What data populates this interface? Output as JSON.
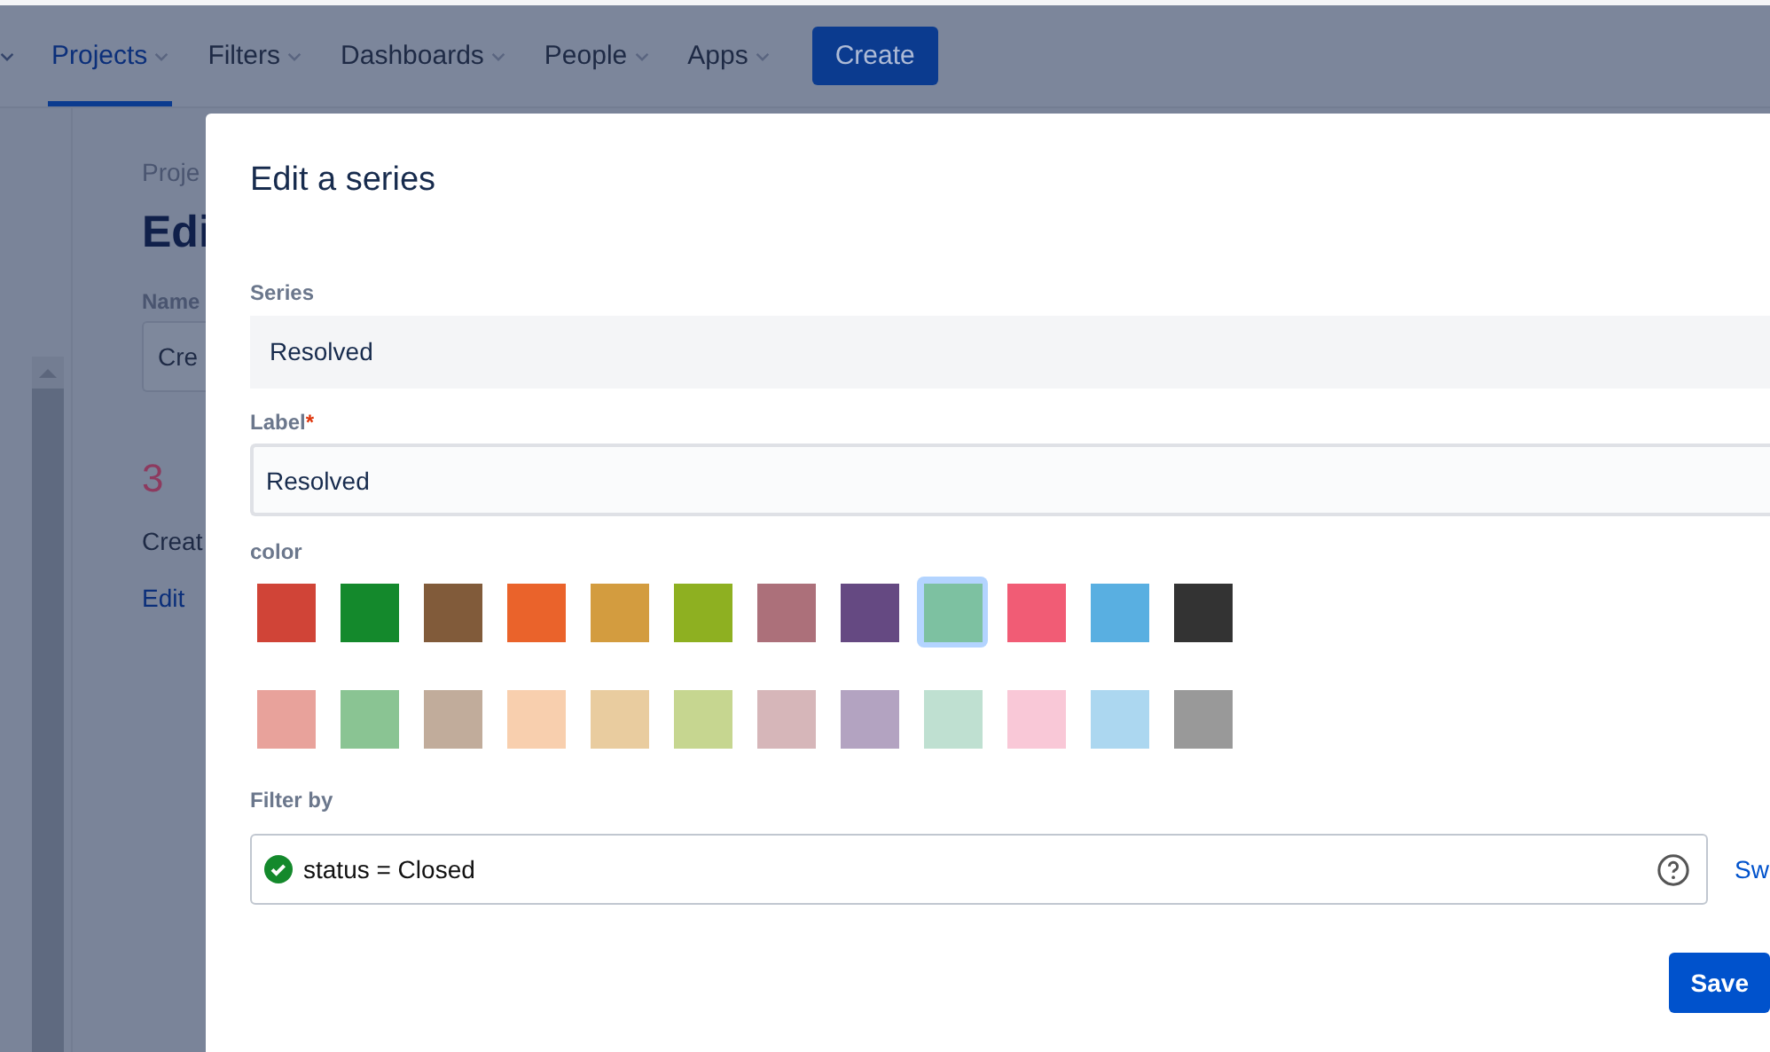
{
  "nav": {
    "items": [
      {
        "label": "Projects",
        "selected": true
      },
      {
        "label": "Filters",
        "selected": false
      },
      {
        "label": "Dashboards",
        "selected": false
      },
      {
        "label": "People",
        "selected": false
      },
      {
        "label": "Apps",
        "selected": false
      }
    ],
    "create_button": "Create"
  },
  "page": {
    "breadcrumb": "Proje",
    "heading": "Edi",
    "name_label": "Name",
    "name_field": "Cre",
    "count": "3",
    "text": "Creat",
    "link": "Edit"
  },
  "dialog": {
    "title": "Edit a series",
    "series": {
      "label": "Series",
      "value": "Resolved"
    },
    "label_field": {
      "label": "Label",
      "required": true,
      "required_mark": "*",
      "value": "Resolved"
    },
    "color": {
      "label": "color",
      "swatches": [
        {
          "color": "#d04437",
          "selected": false
        },
        {
          "color": "#14892c",
          "selected": false
        },
        {
          "color": "#815b3a",
          "selected": false
        },
        {
          "color": "#ea632b",
          "selected": false
        },
        {
          "color": "#d39c3f",
          "selected": false
        },
        {
          "color": "#8eb021",
          "selected": false
        },
        {
          "color": "#ac707a",
          "selected": false
        },
        {
          "color": "#654982",
          "selected": false
        },
        {
          "color": "#7dc1a1",
          "selected": true
        },
        {
          "color": "#f15c75",
          "selected": false
        },
        {
          "color": "#59afe1",
          "selected": false
        },
        {
          "color": "#333333",
          "selected": false
        },
        {
          "color": "#e8a29b",
          "selected": false
        },
        {
          "color": "#8ac493",
          "selected": false
        },
        {
          "color": "#c1ac9b",
          "selected": false
        },
        {
          "color": "#f8cfae",
          "selected": false
        },
        {
          "color": "#e9cc9f",
          "selected": false
        },
        {
          "color": "#c6d690",
          "selected": false
        },
        {
          "color": "#d6b6b9",
          "selected": false
        },
        {
          "color": "#b3a3c1",
          "selected": false
        },
        {
          "color": "#bfe0d1",
          "selected": false
        },
        {
          "color": "#f9c8d7",
          "selected": false
        },
        {
          "color": "#acd7f0",
          "selected": false
        },
        {
          "color": "#999999",
          "selected": false
        }
      ]
    },
    "filter": {
      "label": "Filter by",
      "value": "status = Closed",
      "valid": true,
      "link": "Sw"
    },
    "save_button": "Save"
  }
}
